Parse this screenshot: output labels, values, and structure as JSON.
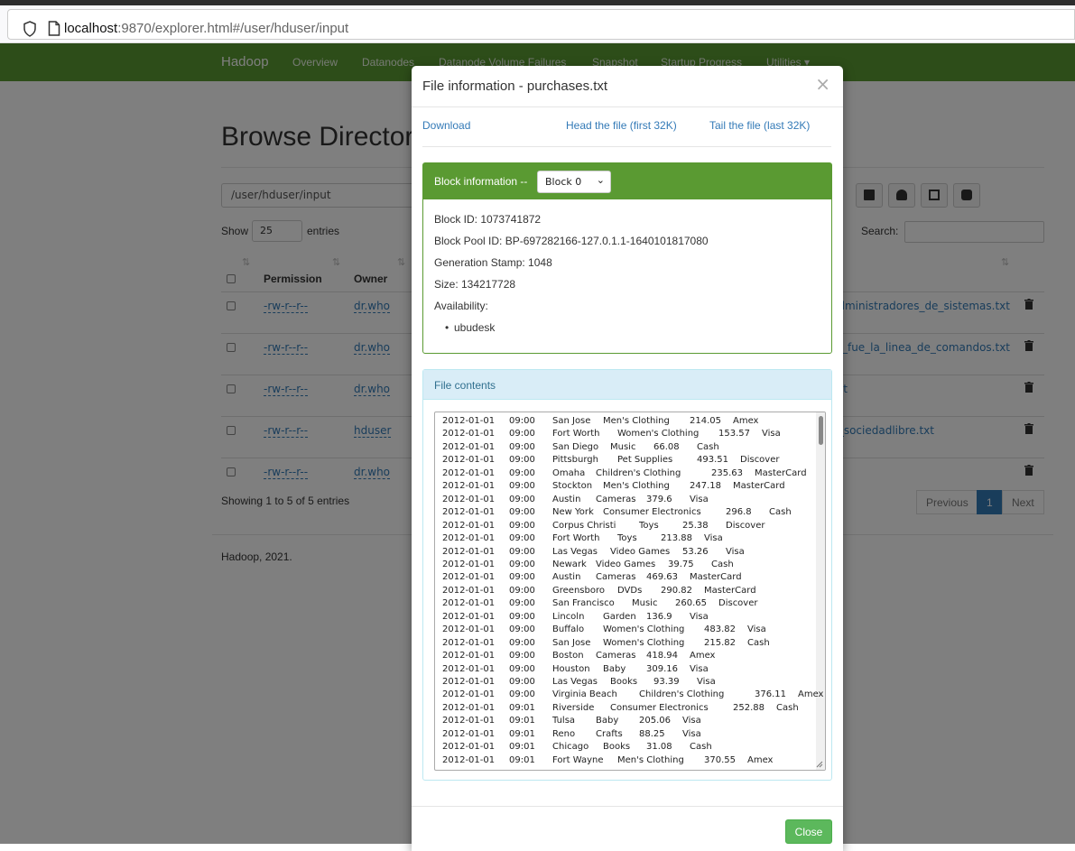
{
  "browser": {
    "url_host": "localhost",
    "url_rest": ":9870/explorer.html#/user/hduser/input"
  },
  "navbar": {
    "brand": "Hadoop",
    "items": [
      "Overview",
      "Datanodes",
      "Datanode Volume Failures",
      "Snapshot",
      "Startup Progress",
      "Utilities ▾"
    ],
    "color": "#5a9a32"
  },
  "page": {
    "title": "Browse Directory",
    "path": "/user/hduser/input",
    "show_label": "Show",
    "entries_select": "25",
    "entries_label": "entries",
    "search_label": "Search:",
    "columns": {
      "permission": "Permission",
      "owner": "Owner"
    },
    "rows": [
      {
        "permission": "-rw-r--r--",
        "owner": "dr.who",
        "name": "administradores_de_sistemas.txt"
      },
      {
        "permission": "-rw-r--r--",
        "owner": "dr.who",
        "name": "pio_fue_la_linea_de_comandos.txt"
      },
      {
        "permission": "-rw-r--r--",
        "owner": "dr.who",
        "name": "t"
      },
      {
        "permission": "-rw-r--r--",
        "owner": "hduser",
        "name": "_sociedadlibre.txt"
      },
      {
        "permission": "-rw-r--r--",
        "owner": "dr.who",
        "name": ""
      }
    ],
    "showing": "Showing 1 to 5 of 5 entries",
    "pager": {
      "previous": "Previous",
      "current": "1",
      "next": "Next"
    },
    "footer": "Hadoop, 2021."
  },
  "modal": {
    "title": "File information - purchases.txt",
    "close_x": "×",
    "links": {
      "download": "Download",
      "head": "Head the file (first 32K)",
      "tail": "Tail the file (last 32K)"
    },
    "block": {
      "label": "Block information --",
      "selected": "Block 0",
      "lines": [
        "Block ID: 1073741872",
        "Block Pool ID: BP-697282166-127.0.1.1-1640101817080",
        "Generation Stamp: 1048",
        "Size: 134217728",
        "Availability:"
      ],
      "availability": [
        "ubudesk"
      ]
    },
    "contents": {
      "label": "File contents",
      "rows": [
        [
          "2012-01-01",
          "09:00",
          "San Jose",
          "Men's Clothing",
          "214.05",
          "Amex"
        ],
        [
          "2012-01-01",
          "09:00",
          "Fort Worth",
          "Women's Clothing",
          "153.57",
          "Visa"
        ],
        [
          "2012-01-01",
          "09:00",
          "San Diego",
          "Music",
          "66.08",
          "Cash"
        ],
        [
          "2012-01-01",
          "09:00",
          "Pittsburgh",
          "Pet Supplies",
          "493.51",
          "Discover"
        ],
        [
          "2012-01-01",
          "09:00",
          "Omaha",
          "Children's Clothing",
          "235.63",
          "MasterCard"
        ],
        [
          "2012-01-01",
          "09:00",
          "Stockton",
          "Men's Clothing",
          "247.18",
          "MasterCard"
        ],
        [
          "2012-01-01",
          "09:00",
          "Austin",
          "Cameras",
          "379.6",
          "Visa"
        ],
        [
          "2012-01-01",
          "09:00",
          "New York",
          "Consumer Electronics",
          "296.8",
          "Cash"
        ],
        [
          "2012-01-01",
          "09:00",
          "Corpus Christi",
          "Toys",
          "25.38",
          "Discover"
        ],
        [
          "2012-01-01",
          "09:00",
          "Fort Worth",
          "Toys",
          "213.88",
          "Visa"
        ],
        [
          "2012-01-01",
          "09:00",
          "Las Vegas",
          "Video Games",
          "53.26",
          "Visa"
        ],
        [
          "2012-01-01",
          "09:00",
          "Newark",
          "Video Games",
          "39.75",
          "Cash"
        ],
        [
          "2012-01-01",
          "09:00",
          "Austin",
          "Cameras",
          "469.63",
          "MasterCard"
        ],
        [
          "2012-01-01",
          "09:00",
          "Greensboro",
          "DVDs",
          "290.82",
          "MasterCard"
        ],
        [
          "2012-01-01",
          "09:00",
          "San Francisco",
          "Music",
          "260.65",
          "Discover"
        ],
        [
          "2012-01-01",
          "09:00",
          "Lincoln",
          "Garden",
          "136.9",
          "Visa"
        ],
        [
          "2012-01-01",
          "09:00",
          "Buffalo",
          "Women's Clothing",
          "483.82",
          "Visa"
        ],
        [
          "2012-01-01",
          "09:00",
          "San Jose",
          "Women's Clothing",
          "215.82",
          "Cash"
        ],
        [
          "2012-01-01",
          "09:00",
          "Boston",
          "Cameras",
          "418.94",
          "Amex"
        ],
        [
          "2012-01-01",
          "09:00",
          "Houston",
          "Baby",
          "309.16",
          "Visa"
        ],
        [
          "2012-01-01",
          "09:00",
          "Las Vegas",
          "Books",
          "93.39",
          "Visa"
        ],
        [
          "2012-01-01",
          "09:00",
          "Virginia Beach",
          "Children's Clothing",
          "376.11",
          "Amex"
        ],
        [
          "2012-01-01",
          "09:01",
          "Riverside",
          "Consumer Electronics",
          "252.88",
          "Cash"
        ],
        [
          "2012-01-01",
          "09:01",
          "Tulsa",
          "Baby",
          "205.06",
          "Visa"
        ],
        [
          "2012-01-01",
          "09:01",
          "Reno",
          "Crafts",
          "88.25",
          "Visa"
        ],
        [
          "2012-01-01",
          "09:01",
          "Chicago",
          "Books",
          "31.08",
          "Cash"
        ],
        [
          "2012-01-01",
          "09:01",
          "Fort Wayne",
          "Men's Clothing",
          "370.55",
          "Amex"
        ]
      ]
    },
    "close_button": "Close"
  }
}
